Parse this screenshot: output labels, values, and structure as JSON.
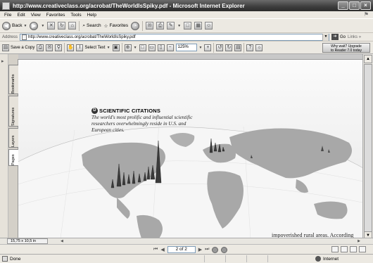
{
  "window": {
    "title": "http://www.creativeclass.org/acrobat/TheWorldIsSpiky.pdf - Microsoft Internet Explorer"
  },
  "menu": [
    "File",
    "Edit",
    "View",
    "Favorites",
    "Tools",
    "Help"
  ],
  "toolbar": {
    "back": "Back",
    "search": "Search",
    "favorites": "Favorites"
  },
  "address": {
    "label": "Address",
    "url": "http://www.creativeclass.org/acrobat/TheWorldIsSpiky.pdf",
    "go": "Go",
    "links": "Links"
  },
  "pdf_toolbar": {
    "save_copy": "Save a Copy",
    "select_text": "Select Text",
    "zoom": "125%",
    "upgrade_line1": "Why wait? Upgrade",
    "upgrade_line2": "to Reader 7.0 today"
  },
  "side_tabs": [
    "Bookmarks",
    "Signatures",
    "Layers",
    "Pages"
  ],
  "document": {
    "heading_badge": "D",
    "heading": "SCIENTIFIC CITATIONS",
    "body": "The world's most prolific and influential scientific researchers overwhelmingly reside in U.S. and European cities.",
    "footnote": "impoverished rural areas. According"
  },
  "page_size": "15,75 x 10,5 in",
  "navigation": {
    "page": "2 of 2"
  },
  "status": {
    "text": "Done",
    "zone": "Internet"
  }
}
